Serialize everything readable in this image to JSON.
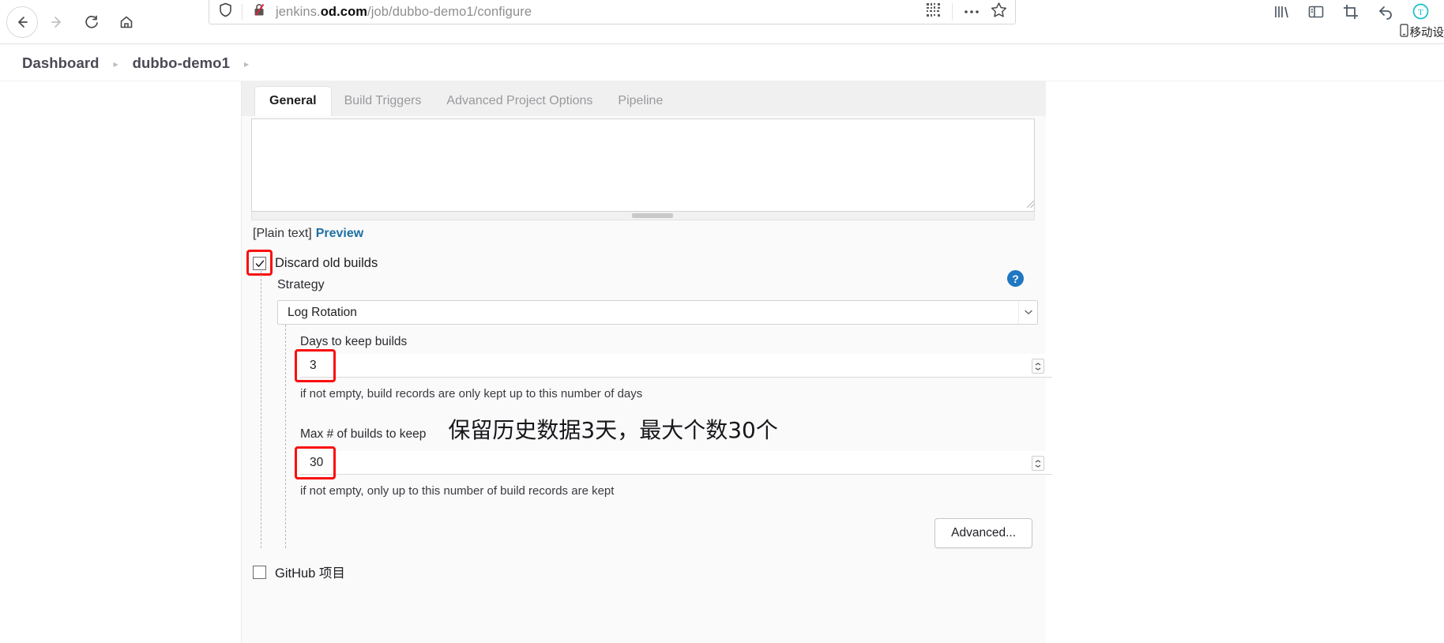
{
  "browser": {
    "nav": {
      "back_icon": "arrow-left-icon",
      "forward_icon": "arrow-right-icon",
      "reload_icon": "reload-icon",
      "home_icon": "home-icon"
    },
    "url": {
      "shield_icon": "tracking-protection-shield-icon",
      "lock_icon": "broken-lock-icon",
      "prefix": "jenkins.",
      "domain": "od.com",
      "path": "/job/dubbo-demo1/configure",
      "full": "jenkins.od.com/job/dubbo-demo1/configure",
      "qr_icon": "qr-code-icon",
      "more_icon": "ellipsis-icon",
      "bookmark_icon": "star-icon"
    },
    "toolbar_icons": [
      "library-icon",
      "sidebar-icon",
      "screenshot-crop-icon",
      "undo-arrow-icon",
      "translate-t-icon"
    ],
    "mobile_badge": {
      "icon": "mobile-device-icon",
      "label": "移动设"
    }
  },
  "breadcrumb": {
    "items": [
      "Dashboard",
      "dubbo-demo1"
    ],
    "separator": "▸"
  },
  "tabs": [
    {
      "label": "General",
      "active": true
    },
    {
      "label": "Build Triggers",
      "active": false
    },
    {
      "label": "Advanced Project Options",
      "active": false
    },
    {
      "label": "Pipeline",
      "active": false
    }
  ],
  "description": {
    "value": "",
    "placeholder": "",
    "markup_note": "[Plain text]",
    "preview_link": "Preview"
  },
  "discard_old_builds": {
    "label": "Discard old builds",
    "checked": true,
    "check_glyph": "✓",
    "help_glyph": "?",
    "strategy_label": "Strategy",
    "strategy_value": "Log Rotation",
    "strategy_options": [
      "Log Rotation"
    ],
    "days_to_keep": {
      "label": "Days to keep builds",
      "value": "3",
      "hint": "if not empty, build records are only kept up to this number of days"
    },
    "max_builds": {
      "label": "Max # of builds to keep",
      "value": "30",
      "hint": "if not empty, only up to this number of build records are kept"
    },
    "advanced_button": "Advanced..."
  },
  "annotation": {
    "chinese_note": "保留历史数据3天，最大个数30个",
    "highlight_color": "#fa0f0f"
  },
  "github_project": {
    "label": "GitHub 项目",
    "checked": false
  }
}
